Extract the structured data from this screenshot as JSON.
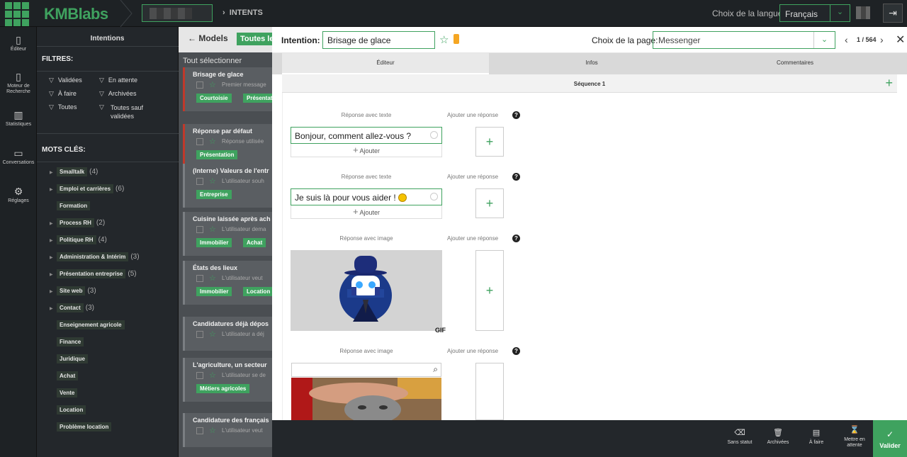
{
  "topbar": {
    "logo": "KMBlabs",
    "breadcrumb": "INTENTS",
    "lang_label": "Choix de la langue:",
    "lang_value": "Français"
  },
  "leftnav": [
    {
      "label": "Éditeur",
      "icon": "editor-icon"
    },
    {
      "label": "Moteur de Recherche",
      "icon": "search-engine-icon"
    },
    {
      "label": "Statistiques",
      "icon": "stats-icon"
    },
    {
      "label": "Conversations",
      "icon": "chat-icon"
    },
    {
      "label": "Réglages",
      "icon": "gear-icon"
    }
  ],
  "filters": {
    "title": "Intentions",
    "filters_label": "FILTRES:",
    "items": [
      "Validées",
      "En attente",
      "À faire",
      "Archivées",
      "Toutes",
      "Toutes sauf validées"
    ],
    "keywords_label": "MOTS CLÉS:",
    "keywords": [
      {
        "label": "Smalltalk",
        "count": "(4)"
      },
      {
        "label": "Emploi et carrières",
        "count": "(6)"
      },
      {
        "label": "Formation",
        "count": ""
      },
      {
        "label": "Process RH",
        "count": "(2)"
      },
      {
        "label": "Politique RH",
        "count": "(4)"
      },
      {
        "label": "Administration & Intérim",
        "count": "(3)"
      },
      {
        "label": "Présentation entreprise",
        "count": "(5)"
      },
      {
        "label": "Site web",
        "count": "(3)"
      },
      {
        "label": "Contact",
        "count": "(3)"
      },
      {
        "label": "Enseignement agricole",
        "count": ""
      },
      {
        "label": "Finance",
        "count": ""
      },
      {
        "label": "Juridique",
        "count": ""
      },
      {
        "label": "Achat",
        "count": ""
      },
      {
        "label": "Vente",
        "count": ""
      },
      {
        "label": "Location",
        "count": ""
      },
      {
        "label": "Problème location",
        "count": ""
      }
    ]
  },
  "list": {
    "models_label": "Models",
    "toutes_label": "Toutes les",
    "select_all": "Tout sélectionner",
    "cards": [
      {
        "title": "Brisage de glace",
        "desc": "Premier message",
        "tags": [
          "Courtoisie",
          "Présentation"
        ]
      },
      {
        "title": "Réponse par défaut",
        "desc": "Réponse utilisée",
        "tags": [
          "Présentation"
        ]
      },
      {
        "title": "(Interne) Valeurs de l'entr",
        "desc": "L'utilisateur souh",
        "tags": [
          "Entreprise"
        ]
      },
      {
        "title": "Cuisine laissée après ach",
        "desc": "L'utilisateur dema",
        "tags": [
          "Immobilier",
          "Achat"
        ]
      },
      {
        "title": "États des lieux",
        "desc": "L'utilisateur veut",
        "tags": [
          "Immobilier",
          "Location"
        ]
      },
      {
        "title": "Candidatures déjà dépos",
        "desc": "L'utilisateur a déj",
        "tags": []
      },
      {
        "title": "L'agriculture, un secteur",
        "desc": "L'utilisateur se de",
        "tags": [
          "Métiers agricoles"
        ]
      },
      {
        "title": "Candidature des français",
        "desc": "L'utilisateur veut",
        "tags": []
      }
    ]
  },
  "editor": {
    "intent_label": "Intention:",
    "intent_value": "Brisage de glace",
    "page_label": "Choix de la page:",
    "page_value": "Messenger",
    "pager": "1 / 564",
    "tabs": [
      "Éditeur",
      "Infos",
      "Commentaires"
    ],
    "sequence": "Séquence 1",
    "text_label": "Réponse avec texte",
    "image_label": "Réponse avec image",
    "add_reply": "Ajouter une réponse",
    "add": "Ajouter",
    "responses": [
      "Bonjour, comment allez-vous ?",
      "Je suis là pour vous aider !"
    ],
    "gif": "GIF"
  },
  "actions": [
    {
      "label": "Sans statut",
      "icon": "untag-icon"
    },
    {
      "label": "Archivées",
      "icon": "trash-icon"
    },
    {
      "label": "À faire",
      "icon": "todo-icon"
    },
    {
      "label": "Mettre en attente",
      "icon": "hourglass-icon"
    }
  ],
  "valider": "Valider",
  "colors": {
    "accent": "#3fa25f",
    "warning": "#c0392b"
  }
}
